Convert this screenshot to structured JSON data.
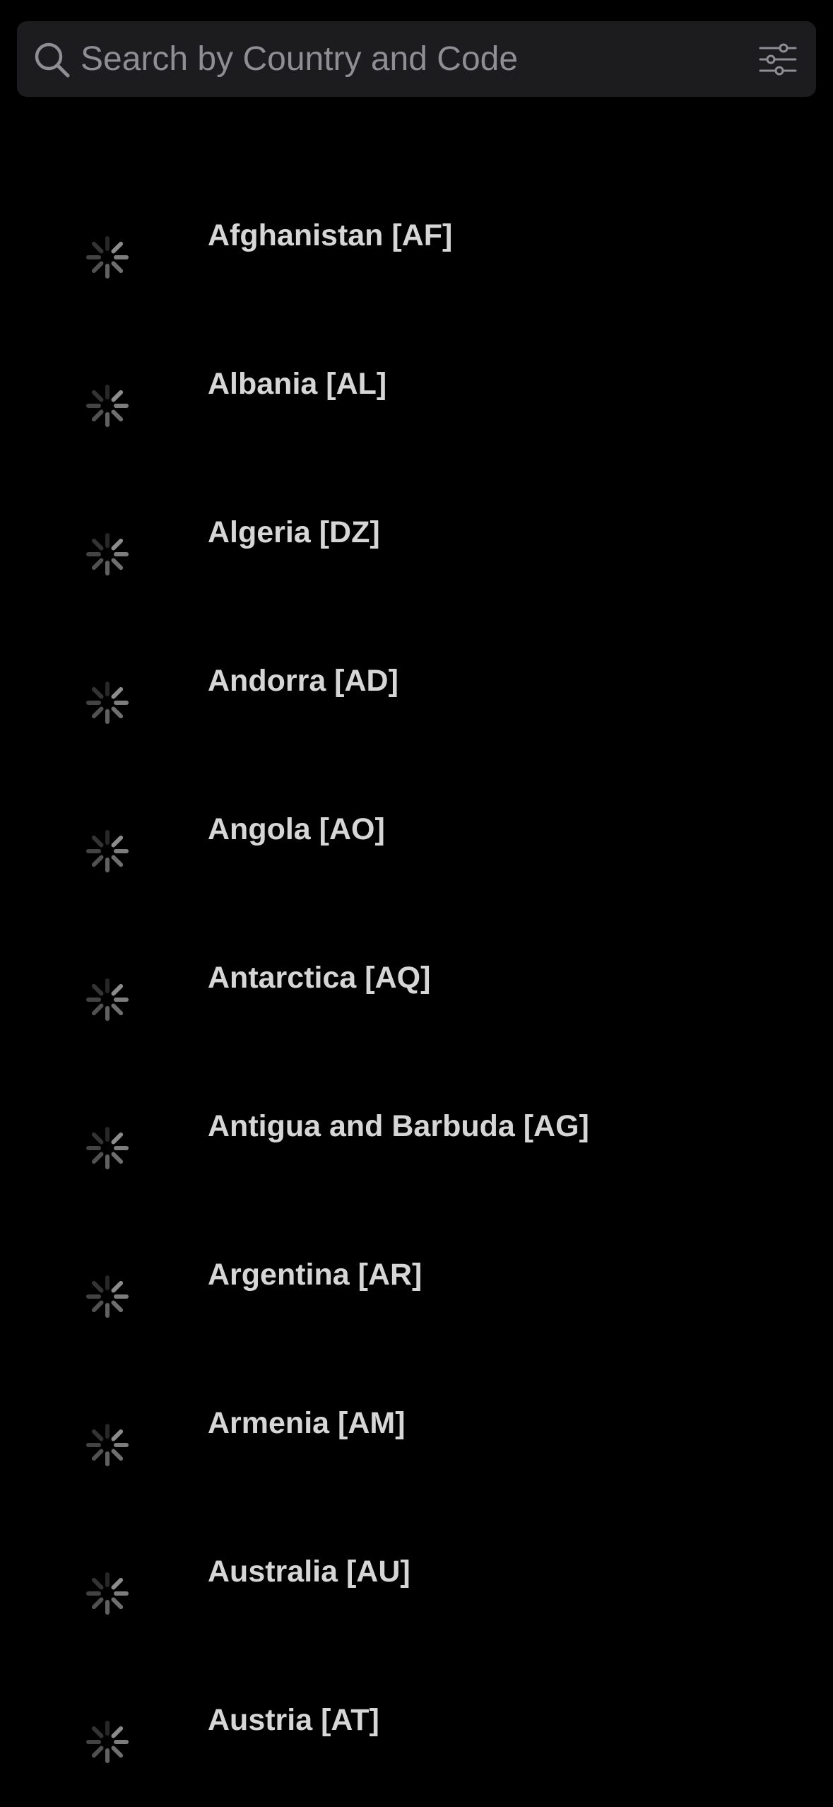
{
  "search": {
    "placeholder": "Search by Country and Code",
    "value": "",
    "icon": "search-icon",
    "filter_icon": "sliders-icon"
  },
  "colors": {
    "background": "#000000",
    "search_background": "#1c1c1e",
    "placeholder": "#8e8e93",
    "text": "#d6d6d6",
    "spinner": "#9a9a9a"
  },
  "countries": [
    {
      "label": "Afghanistan [AF]",
      "flag": "loading-spinner-icon"
    },
    {
      "label": "Albania [AL]",
      "flag": "loading-spinner-icon"
    },
    {
      "label": "Algeria [DZ]",
      "flag": "loading-spinner-icon"
    },
    {
      "label": "Andorra [AD]",
      "flag": "loading-spinner-icon"
    },
    {
      "label": "Angola [AO]",
      "flag": "loading-spinner-icon"
    },
    {
      "label": "Antarctica [AQ]",
      "flag": "loading-spinner-icon"
    },
    {
      "label": "Antigua and Barbuda [AG]",
      "flag": "loading-spinner-icon"
    },
    {
      "label": "Argentina [AR]",
      "flag": "loading-spinner-icon"
    },
    {
      "label": "Armenia [AM]",
      "flag": "loading-spinner-icon"
    },
    {
      "label": "Australia [AU]",
      "flag": "loading-spinner-icon"
    },
    {
      "label": "Austria [AT]",
      "flag": "loading-spinner-icon"
    }
  ]
}
